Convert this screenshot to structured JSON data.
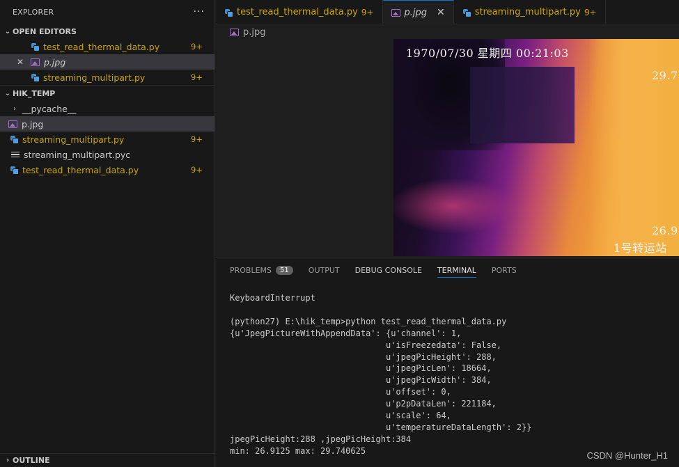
{
  "sidebar": {
    "title": "EXPLORER",
    "more": "···",
    "open_editors": {
      "label": "OPEN EDITORS",
      "items": [
        {
          "name": "test_read_thermal_data.py",
          "badge": "9+"
        },
        {
          "name": "p.jpg",
          "close": "✕"
        },
        {
          "name": "streaming_multipart.py",
          "badge": "9+"
        }
      ]
    },
    "folder": {
      "label": "HIK_TEMP",
      "items": [
        {
          "name": "__pycache__"
        },
        {
          "name": "p.jpg"
        },
        {
          "name": "streaming_multipart.py",
          "badge": "9+"
        },
        {
          "name": "streaming_multipart.pyc"
        },
        {
          "name": "test_read_thermal_data.py",
          "badge": "9+"
        }
      ]
    },
    "outline": "OUTLINE"
  },
  "tabs": [
    {
      "name": "test_read_thermal_data.py",
      "badge": "9+"
    },
    {
      "name": "p.jpg",
      "close": "✕"
    },
    {
      "name": "streaming_multipart.py",
      "badge": "9+"
    }
  ],
  "breadcrumb": "p.jpg",
  "thermal": {
    "timestamp": "1970/07/30 星期四 00:21:03",
    "max_label": "29.7",
    "min_label": "26.9",
    "station": "1号转运站"
  },
  "panel": {
    "tabs": [
      {
        "label": "PROBLEMS",
        "badge": "51"
      },
      {
        "label": "OUTPUT"
      },
      {
        "label": "DEBUG CONSOLE"
      },
      {
        "label": "TERMINAL"
      },
      {
        "label": "PORTS"
      }
    ],
    "terminal": "KeyboardInterrupt\n\n(python27) E:\\hik_temp>python test_read_thermal_data.py\n{u'JpegPictureWithAppendData': {u'channel': 1,\n                               u'isFreezedata': False,\n                               u'jpegPicHeight': 288,\n                               u'jpegPicLen': 18664,\n                               u'jpegPicWidth': 384,\n                               u'offset': 0,\n                               u'p2pDataLen': 221184,\n                               u'scale': 64,\n                               u'temperatureDataLength': 2}}\njpegPicHeight:288 ,jpegPicHeight:384\nmin: 26.9125 max: 29.740625"
  },
  "watermark": "CSDN @Hunter_H1"
}
